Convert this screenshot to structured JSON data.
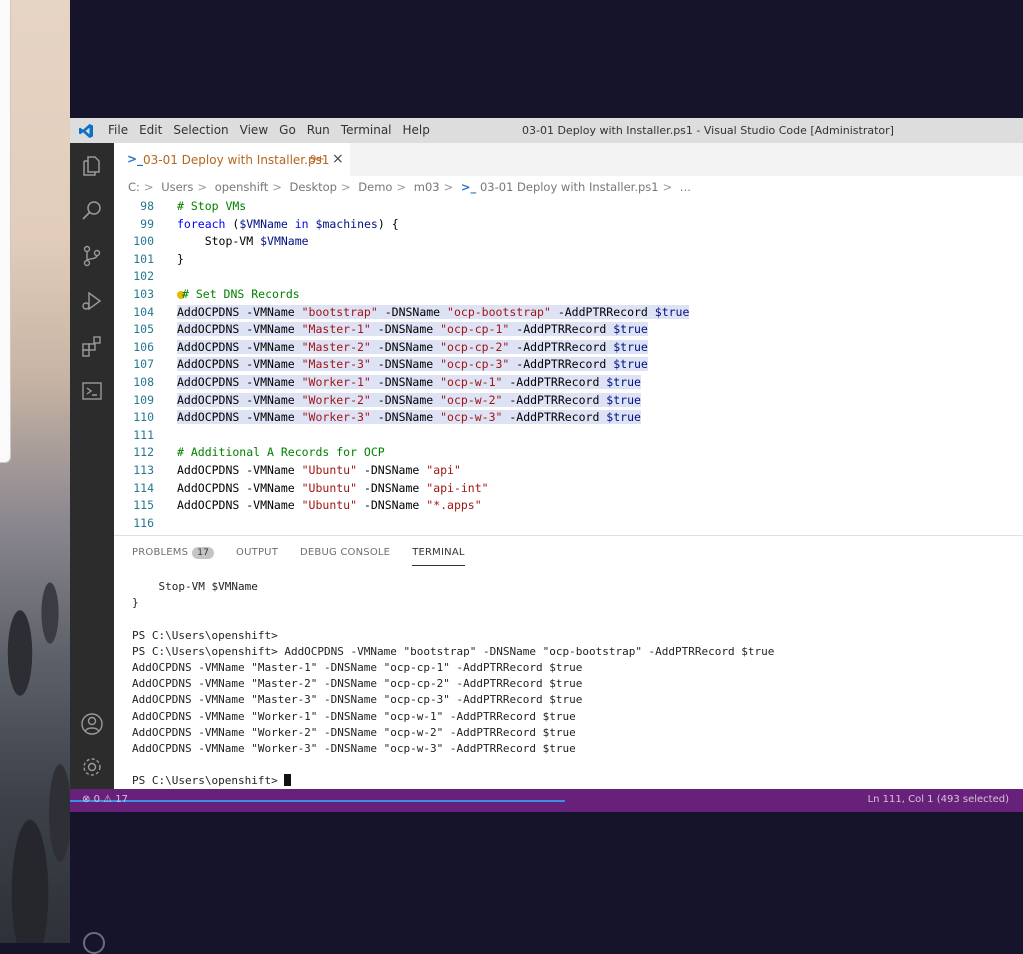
{
  "window": {
    "title": "03-01 Deploy with Installer.ps1 - Visual Studio Code [Administrator]",
    "menu": [
      "File",
      "Edit",
      "Selection",
      "View",
      "Go",
      "Run",
      "Terminal",
      "Help"
    ]
  },
  "activitybar": {
    "icons": [
      "explorer-icon",
      "search-icon",
      "source-control-icon",
      "run-debug-icon",
      "extensions-icon",
      "powershell-icon",
      "account-icon",
      "settings-gear-icon"
    ]
  },
  "tab": {
    "icon": "powershell-icon",
    "label": "03-01 Deploy with Installer.ps1",
    "badge": "9+",
    "close": "×"
  },
  "breadcrumb": [
    "C:",
    "Users",
    "openshift",
    "Desktop",
    "Demo",
    "m03",
    "03-01 Deploy with Installer.ps1",
    "..."
  ],
  "code_lines": [
    {
      "n": "98",
      "text": "# Stop VMs"
    },
    {
      "n": "99",
      "text": "foreach ($VMName in $machines) {"
    },
    {
      "n": "100",
      "text": "    Stop-VM $VMName"
    },
    {
      "n": "101",
      "text": "}"
    },
    {
      "n": "102",
      "text": ""
    },
    {
      "n": "103",
      "text": "# Set DNS Records"
    },
    {
      "n": "104",
      "text": "AddOCPDNS -VMName \"bootstrap\" -DNSName \"ocp-bootstrap\" -AddPTRRecord $true"
    },
    {
      "n": "105",
      "text": "AddOCPDNS -VMName \"Master-1\" -DNSName \"ocp-cp-1\" -AddPTRRecord $true"
    },
    {
      "n": "106",
      "text": "AddOCPDNS -VMName \"Master-2\" -DNSName \"ocp-cp-2\" -AddPTRRecord $true"
    },
    {
      "n": "107",
      "text": "AddOCPDNS -VMName \"Master-3\" -DNSName \"ocp-cp-3\" -AddPTRRecord $true"
    },
    {
      "n": "108",
      "text": "AddOCPDNS -VMName \"Worker-1\" -DNSName \"ocp-w-1\" -AddPTRRecord $true"
    },
    {
      "n": "109",
      "text": "AddOCPDNS -VMName \"Worker-2\" -DNSName \"ocp-w-2\" -AddPTRRecord $true"
    },
    {
      "n": "110",
      "text": "AddOCPDNS -VMName \"Worker-3\" -DNSName \"ocp-w-3\" -AddPTRRecord $true"
    },
    {
      "n": "111",
      "text": ""
    },
    {
      "n": "112",
      "text": "# Additional A Records for OCP"
    },
    {
      "n": "113",
      "text": "AddOCPDNS -VMName \"Ubuntu\" -DNSName \"api\""
    },
    {
      "n": "114",
      "text": "AddOCPDNS -VMName \"Ubuntu\" -DNSName \"api-int\""
    },
    {
      "n": "115",
      "text": "AddOCPDNS -VMName \"Ubuntu\" -DNSName \"*.apps\""
    },
    {
      "n": "116",
      "text": ""
    }
  ],
  "panel": {
    "tabs": [
      "PROBLEMS",
      "OUTPUT",
      "DEBUG CONSOLE",
      "TERMINAL"
    ],
    "active_tab": "TERMINAL",
    "problems_count": "17"
  },
  "terminal_lines": [
    "    Stop-VM $VMName",
    "}",
    "",
    "PS C:\\Users\\openshift>",
    "PS C:\\Users\\openshift> AddOCPDNS -VMName \"bootstrap\" -DNSName \"ocp-bootstrap\" -AddPTRRecord $true",
    "AddOCPDNS -VMName \"Master-1\" -DNSName \"ocp-cp-1\" -AddPTRRecord $true",
    "AddOCPDNS -VMName \"Master-2\" -DNSName \"ocp-cp-2\" -AddPTRRecord $true",
    "AddOCPDNS -VMName \"Master-3\" -DNSName \"ocp-cp-3\" -AddPTRRecord $true",
    "AddOCPDNS -VMName \"Worker-1\" -DNSName \"ocp-w-1\" -AddPTRRecord $true",
    "AddOCPDNS -VMName \"Worker-2\" -DNSName \"ocp-w-2\" -AddPTRRecord $true",
    "AddOCPDNS -VMName \"Worker-3\" -DNSName \"ocp-w-3\" -AddPTRRecord $true",
    "",
    "PS C:\\Users\\openshift> "
  ],
  "statusbar": {
    "errors": "0",
    "warnings": "17",
    "position": "Ln 111, Col 1 (493 selected)",
    "color": "#68217a"
  }
}
